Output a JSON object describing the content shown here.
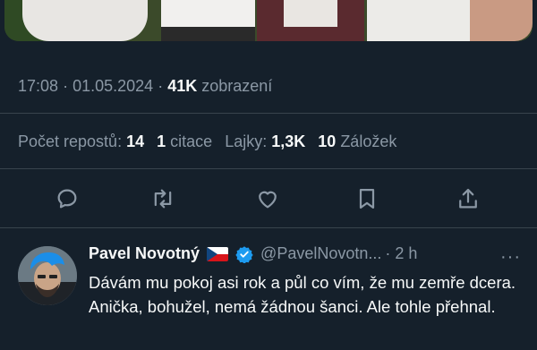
{
  "tweet": {
    "time": "17:08",
    "date": "01.05.2024",
    "views_count": "41K",
    "views_label": "zobrazení",
    "separator": "·"
  },
  "stats": {
    "reposts_label": "Počet repostů:",
    "reposts_count": "14",
    "quotes_count": "1",
    "quotes_label": "citace",
    "likes_label": "Lajky:",
    "likes_count": "1,3K",
    "bookmarks_count": "10",
    "bookmarks_label": "Záložek"
  },
  "actions": [
    "reply-icon",
    "repost-icon",
    "like-icon",
    "bookmark-icon",
    "share-icon"
  ],
  "reply": {
    "name": "Pavel Novotný",
    "handle": "@PavelNovotn...",
    "time": "· 2 h",
    "more": "···",
    "text": "Dávám mu pokoj asi rok a půl co vím, že mu zemře dcera. Anička, bohužel, nemá žádnou šanci. Ale tohle přehnal."
  },
  "colors": {
    "background": "#15202b",
    "secondary_text": "#8b98a5",
    "verified": "#1d9bf0",
    "divider": "#38444d"
  }
}
